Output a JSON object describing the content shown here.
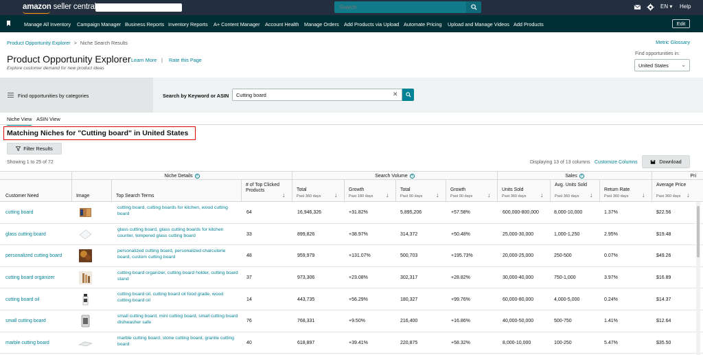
{
  "top": {
    "logo_amazon": "amazon",
    "logo_rest": "seller central",
    "search_placeholder": "Search",
    "lang": "EN",
    "help": "Help"
  },
  "nav": {
    "items": [
      "Manage All Inventory",
      "Campaign Manager",
      "Business Reports",
      "Inventory Reports",
      "A+ Content Manager",
      "Account Health",
      "Manage Orders",
      "Add Products via Upload",
      "Automate Pricing",
      "Upload and Manage Videos",
      "Add Products"
    ],
    "edit": "Edit"
  },
  "breadcrumb": {
    "parent": "Product Opportunity Explorer",
    "separator": ">",
    "current": "Niche Search Results"
  },
  "metric_glossary": "Metric Glossary",
  "header": {
    "title": "Product Opportunity Explorer",
    "subtitle": "Explore customer demand for new product ideas",
    "learn_more": "Learn More",
    "pipe": "|",
    "rate": "Rate this Page",
    "find_label": "Find opportunities in:",
    "country": "United States"
  },
  "search": {
    "categories_label": "Find opportunities by categories",
    "keyword_label": "Search by Keyword or ASIN",
    "keyword_value": "Cutting board"
  },
  "tabs": [
    "Niche View",
    "ASIN View"
  ],
  "results_title": "Matching Niches for \"Cutting board\" in United States",
  "filter_button": "Filter Results",
  "showing": "Showing 1 to 25 of 72",
  "displaying": "Displaying 13 of 13 columns",
  "customize": "Customize Columns",
  "download": "Download",
  "table": {
    "groups": [
      "Niche Details",
      "Search Volume",
      "Sales",
      "Pri"
    ],
    "columns": [
      {
        "title": "Customer Need",
        "sub": ""
      },
      {
        "title": "Image",
        "sub": ""
      },
      {
        "title": "Top Search Terms",
        "sub": ""
      },
      {
        "title": "# of Top Clicked Products",
        "sub": ""
      },
      {
        "title": "Total",
        "sub": "Past 360 days"
      },
      {
        "title": "Growth",
        "sub": "Past 180 days"
      },
      {
        "title": "Total",
        "sub": "Past 90 days"
      },
      {
        "title": "Growth",
        "sub": "Past 90 days"
      },
      {
        "title": "Units Sold",
        "sub": "Past 360 days"
      },
      {
        "title": "Avg. Units Sold",
        "sub": "Past 360 days"
      },
      {
        "title": "Return Rate",
        "sub": "Past 360 days"
      },
      {
        "title": "Average Price",
        "sub": "Past 360 days"
      }
    ],
    "rows": [
      {
        "need": "cutting board",
        "terms": "cutting board, cutting boards for kitchen, wood cutting board",
        "clicked": "64",
        "sv_total360": "16,946,326",
        "sv_growth180": "+31.82%",
        "sv_total90": "5,895,206",
        "sv_growth90": "+57.58%",
        "units": "600,000-800,000",
        "avg_units": "8,000-10,000",
        "return_rate": "1.37%",
        "price": "$22.56",
        "img": "wood"
      },
      {
        "need": "glass cutting board",
        "terms": "glass cutting board, glass cutting boards for kitchen counter, tempered glass cutting board",
        "clicked": "33",
        "sv_total360": "899,826",
        "sv_growth180": "+38.97%",
        "sv_total90": "314,372",
        "sv_growth90": "+50.48%",
        "units": "25,000-30,000",
        "avg_units": "1,000-1,250",
        "return_rate": "2.95%",
        "price": "$19.48",
        "img": "glass"
      },
      {
        "need": "personalized cutting board",
        "terms": "personalized cutting board, personalized charcuterie board, custom cutting board",
        "clicked": "48",
        "sv_total360": "959,979",
        "sv_growth180": "+131.07%",
        "sv_total90": "500,703",
        "sv_growth90": "+195.73%",
        "units": "20,000-25,000",
        "avg_units": "250-500",
        "return_rate": "0.07%",
        "price": "$49.26",
        "img": "personal"
      },
      {
        "need": "cutting board organizer",
        "terms": "cutting board organizer, cutting board holder, cutting board stand",
        "clicked": "37",
        "sv_total360": "973,306",
        "sv_growth180": "+23.08%",
        "sv_total90": "302,317",
        "sv_growth90": "+28.82%",
        "units": "30,000-40,000",
        "avg_units": "750-1,000",
        "return_rate": "3.97%",
        "price": "$16.89",
        "img": "organizer"
      },
      {
        "need": "cutting board oil",
        "terms": "cutting board oil, cutting board oil food grade, wood cutting board oil",
        "clicked": "14",
        "sv_total360": "443,735",
        "sv_growth180": "+56.29%",
        "sv_total90": "180,327",
        "sv_growth90": "+99.76%",
        "units": "60,000-80,000",
        "avg_units": "4,000-5,000",
        "return_rate": "0.24%",
        "price": "$14.37",
        "img": "oil"
      },
      {
        "need": "small cutting board",
        "terms": "small cutting board, mini cutting board, small cutting board dishwasher safe",
        "clicked": "76",
        "sv_total360": "768,331",
        "sv_growth180": "+9.50%",
        "sv_total90": "216,400",
        "sv_growth90": "+16.86%",
        "units": "40,000-50,000",
        "avg_units": "500-750",
        "return_rate": "1.41%",
        "price": "$12.64",
        "img": "small"
      },
      {
        "need": "marble cutting board",
        "terms": "marble cutting board, stone cutting board, granite cutting board",
        "clicked": "40",
        "sv_total360": "618,897",
        "sv_growth180": "+39.41%",
        "sv_total90": "220,875",
        "sv_growth90": "+58.32%",
        "units": "8,000-10,000",
        "avg_units": "100-250",
        "return_rate": "5.47%",
        "price": "$35.50",
        "img": "marble"
      }
    ]
  },
  "colors": {
    "topbar": "#232f3e",
    "navbar": "#002f36",
    "teal": "#008296",
    "highlight": "#dd0000"
  }
}
